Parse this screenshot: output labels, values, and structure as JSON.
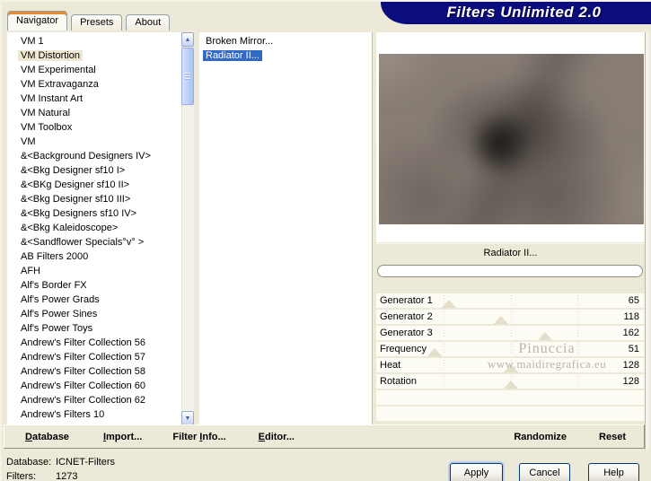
{
  "title": "Filters Unlimited 2.0",
  "tabs": [
    {
      "label": "Navigator",
      "active": true
    },
    {
      "label": "Presets",
      "active": false
    },
    {
      "label": "About",
      "active": false
    }
  ],
  "category_list": {
    "selected_index": 1,
    "items": [
      "VM 1",
      "VM Distortion",
      "VM Experimental",
      "VM Extravaganza",
      "VM Instant Art",
      "VM Natural",
      "VM Toolbox",
      "VM",
      "&<Background Designers IV>",
      "&<Bkg Designer sf10 I>",
      "&<BKg Designer sf10 II>",
      "&<Bkg Designer sf10 III>",
      "&<Bkg Designers sf10 IV>",
      "&<Bkg Kaleidoscope>",
      "&<Sandflower Specials°v° >",
      "AB Filters 2000",
      "AFH",
      "Alf's Border FX",
      "Alf's Power Grads",
      "Alf's Power Sines",
      "Alf's Power Toys",
      "Andrew's Filter Collection 56",
      "Andrew's Filter Collection 57",
      "Andrew's Filter Collection 58",
      "Andrew's Filter Collection 60",
      "Andrew's Filter Collection 62",
      "Andrew's Filters 10"
    ]
  },
  "filter_list": {
    "selected_index": 1,
    "items": [
      "Broken Mirror...",
      "Radiator II..."
    ]
  },
  "preview": {
    "filter_name": "Radiator II...",
    "progress_percent": 0
  },
  "sliders": {
    "max": 255,
    "empty_rows": 2,
    "items": [
      {
        "label": "Generator 1",
        "value": 65
      },
      {
        "label": "Generator 2",
        "value": 118
      },
      {
        "label": "Generator 3",
        "value": 162
      },
      {
        "label": "Frequency",
        "value": 51
      },
      {
        "label": "Heat",
        "value": 128
      },
      {
        "label": "Rotation",
        "value": 128
      }
    ]
  },
  "toolbar": {
    "left": [
      {
        "t1": "",
        "u": "D",
        "t2": "atabase"
      },
      {
        "t1": "",
        "u": "I",
        "t2": "mport..."
      },
      {
        "t1": "Filter ",
        "u": "I",
        "t2": "nfo..."
      },
      {
        "t1": "",
        "u": "E",
        "t2": "ditor..."
      }
    ],
    "right": [
      {
        "t1": "Randomize",
        "u": "",
        "t2": ""
      },
      {
        "t1": "Reset",
        "u": "",
        "t2": ""
      }
    ]
  },
  "status": {
    "rows": [
      {
        "label": "Database:",
        "value": "ICNET-Filters"
      },
      {
        "label": "Filters:",
        "value": "1273"
      }
    ]
  },
  "dialog_buttons": [
    {
      "label": "Apply",
      "default": true
    },
    {
      "label": "Cancel",
      "default": false
    },
    {
      "label": "Help",
      "default": false
    }
  ],
  "watermark": {
    "line1": "Pinuccia",
    "line2": "www.maidiregrafica.eu"
  },
  "scrollbar_icons": {
    "up": "▲",
    "down": "▼"
  },
  "colors": {
    "dialog_bg": "#ece9d8",
    "banner": "#0b0c7e",
    "selection_blue": "#316ac5",
    "selection_cream": "#eee8d2",
    "tab_accent": "#e68b2c",
    "slider_row_bg": "#fcfcf5",
    "slider_triangle": "#e4decb",
    "watermark_text": "#bcb3a5"
  }
}
